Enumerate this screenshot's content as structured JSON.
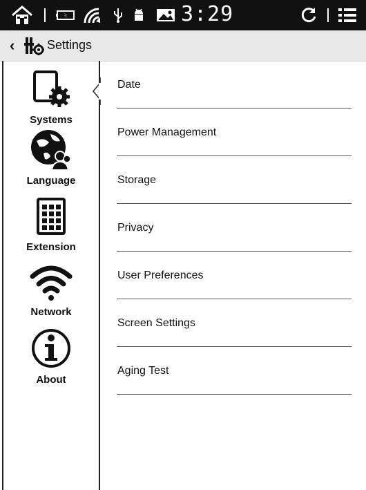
{
  "status_bar": {
    "time": "3:29",
    "icons": [
      "home-icon",
      "battery-icon",
      "wifi-signal-icon",
      "usb-icon",
      "android-icon",
      "image-icon",
      "refresh-icon",
      "menu-list-icon"
    ]
  },
  "title_bar": {
    "back_symbol": "‹",
    "title": "Settings"
  },
  "sidebar": {
    "items": [
      {
        "label": "Systems",
        "icon": "system-settings-icon"
      },
      {
        "label": "Language",
        "icon": "language-globe-icon"
      },
      {
        "label": "Extension",
        "icon": "extension-grid-icon"
      },
      {
        "label": "Network",
        "icon": "wifi-icon"
      },
      {
        "label": "About",
        "icon": "info-icon"
      }
    ],
    "selected": "Systems"
  },
  "menu": {
    "items": [
      {
        "label": "Date"
      },
      {
        "label": "Power Management"
      },
      {
        "label": "Storage"
      },
      {
        "label": "Privacy"
      },
      {
        "label": "User Preferences"
      },
      {
        "label": "Screen Settings"
      },
      {
        "label": "Aging Test"
      }
    ]
  }
}
